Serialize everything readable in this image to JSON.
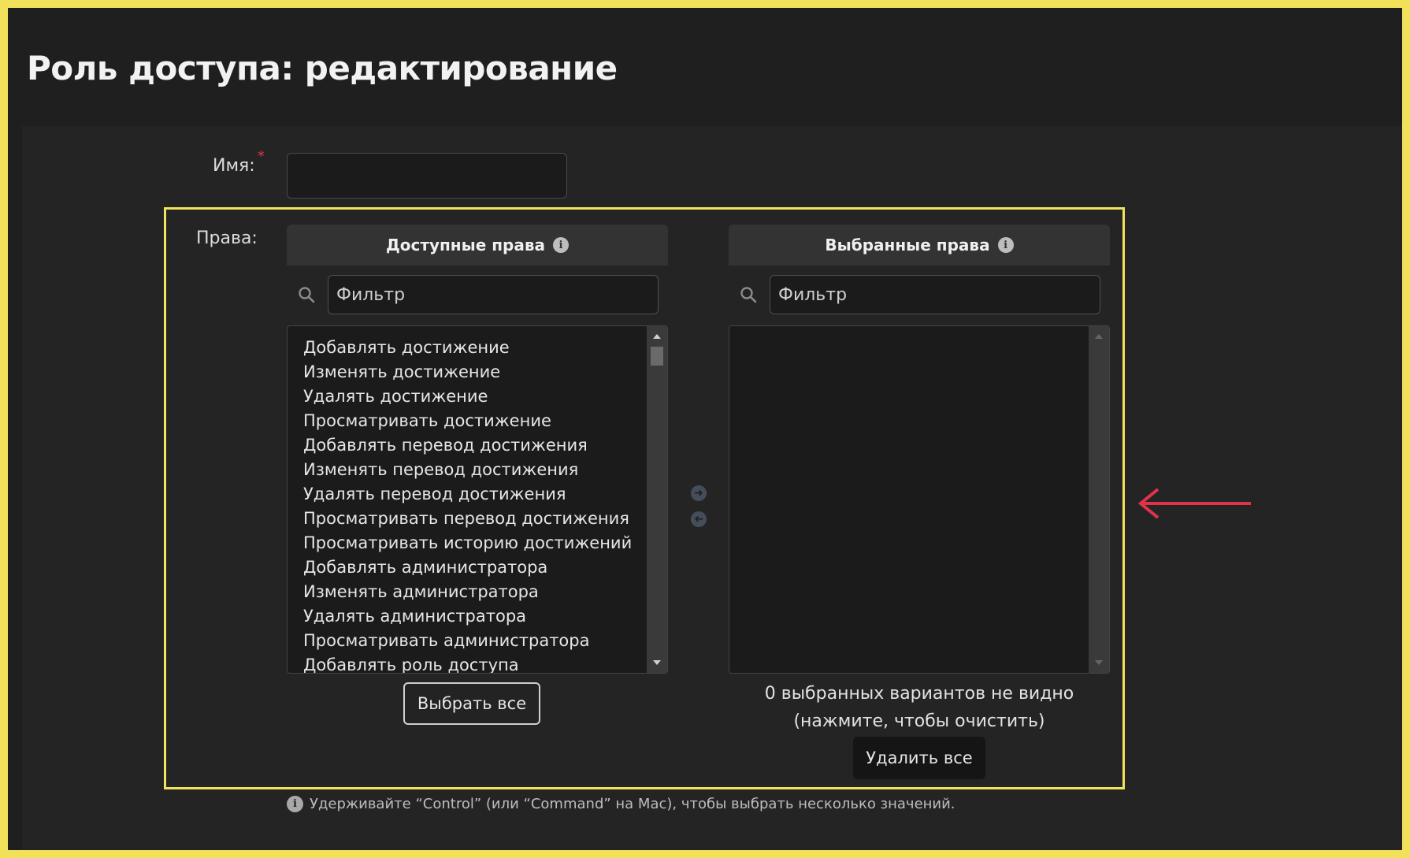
{
  "page": {
    "title": "Роль доступа: редактирование"
  },
  "form": {
    "name_label": "Имя:",
    "required_mark": "*",
    "name_value": "",
    "permissions_label": "Права:"
  },
  "available": {
    "header": "Доступные права",
    "info_icon": "i",
    "filter_placeholder": "Фильтр",
    "items": [
      "Добавлять достижение",
      "Изменять достижение",
      "Удалять достижение",
      "Просматривать достижение",
      "Добавлять перевод достижения",
      "Изменять перевод достижения",
      "Удалять перевод достижения",
      "Просматривать перевод достижения",
      "Просматривать историю достижений",
      "Добавлять администратора",
      "Изменять администратора",
      "Удалять администратора",
      "Просматривать администратора",
      "Добавлять роль доступа"
    ],
    "choose_all_label": "Выбрать все"
  },
  "chosen": {
    "header": "Выбранные права",
    "info_icon": "i",
    "filter_placeholder": "Фильтр",
    "items": [],
    "hidden_message": "0 выбранных вариантов не видно (нажмите, чтобы очистить)",
    "remove_all_label": "Удалить все"
  },
  "help": {
    "icon": "i",
    "text": "Удерживайте “Control” (или “Command” на Mac), чтобы выбрать несколько значений."
  },
  "icons": {
    "search": "search-icon",
    "add": "arrow-right-icon",
    "remove": "arrow-left-icon"
  },
  "colors": {
    "highlight": "#f3e25c",
    "annotation_arrow": "#e0334a",
    "required": "#e0334a"
  }
}
